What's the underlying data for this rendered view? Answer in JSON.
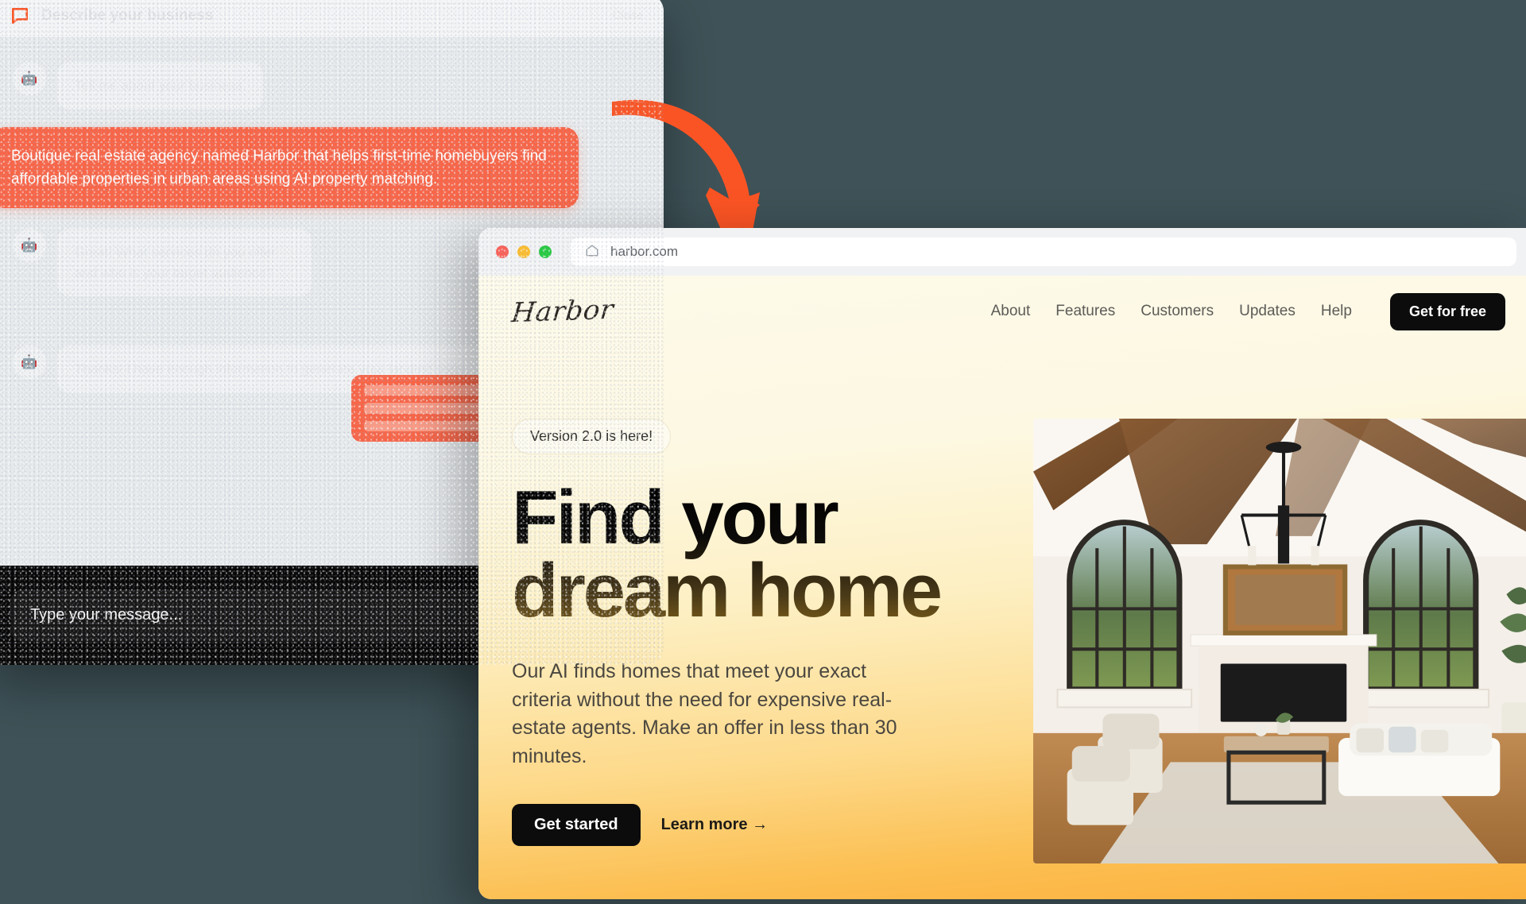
{
  "background_color": "#3e5257",
  "accent_color": "#f96547",
  "chat": {
    "header": {
      "icon": "chat-bubble-icon",
      "title": "Describe your business",
      "close_label": "Close"
    },
    "messages": [
      {
        "role": "bot",
        "text": "Tell me about your business.",
        "faded": true
      },
      {
        "role": "user",
        "text": "Boutique real estate agency named Harbor that helps first-time homebuyers find affordable properties in urban areas using AI property matching.",
        "faded": false
      },
      {
        "role": "bot",
        "text": "Great! What services do you offer and who is your target audience?",
        "faded": true
      },
      {
        "role": "bot",
        "text": "Thanks! I have enough information to generate your landing page.",
        "faded": true
      }
    ],
    "skeleton_lines": 3,
    "input": {
      "placeholder": "Type your message...",
      "value": ""
    }
  },
  "arrow": {
    "name": "curved-arrow-icon",
    "color": "#fb5424",
    "direction": "down-right"
  },
  "browser": {
    "traffic_lights": [
      {
        "name": "close",
        "color": "#fb6158"
      },
      {
        "name": "minimize",
        "color": "#fcbd2e"
      },
      {
        "name": "maximize",
        "color": "#28ca42"
      }
    ],
    "url": "harbor.com",
    "home_icon": "home-icon"
  },
  "site": {
    "logo": "Harbor",
    "nav": [
      {
        "label": "About"
      },
      {
        "label": "Features"
      },
      {
        "label": "Customers"
      },
      {
        "label": "Updates"
      },
      {
        "label": "Help"
      }
    ],
    "nav_cta": "Get for free",
    "hero": {
      "badge": "Version 2.0 is here!",
      "headline_line1": "Find your",
      "headline_line2": "dream home",
      "subtitle": "Our AI finds homes that meet your exact criteria without the need for expensive real-estate agents. Make an offer in less than 30 minutes.",
      "primary_cta": "Get started",
      "secondary_cta": "Learn more →",
      "image_alt": "living-room-photo"
    }
  }
}
